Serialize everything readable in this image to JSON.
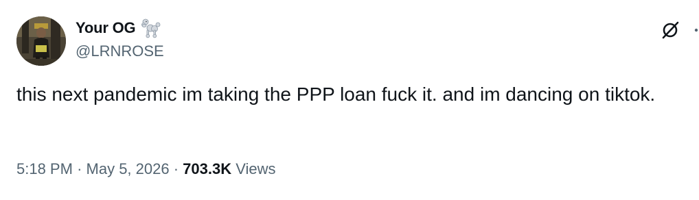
{
  "user": {
    "display_name": "Your OG",
    "name_emoji": "poodle-emoji",
    "handle": "@LRNROSE"
  },
  "tweet": {
    "text": "this next pandemic im taking the PPP loan fuck it. and im dancing on tiktok."
  },
  "meta": {
    "time": "5:18 PM",
    "separator": "·",
    "date": "May 5, 2026",
    "views_count": "703.3K",
    "views_label": "Views"
  },
  "icons": {
    "grok": "grok-icon",
    "more": "more-dots-icon"
  },
  "colors": {
    "text_primary": "#0f1419",
    "text_secondary": "#536471",
    "background": "#ffffff"
  }
}
